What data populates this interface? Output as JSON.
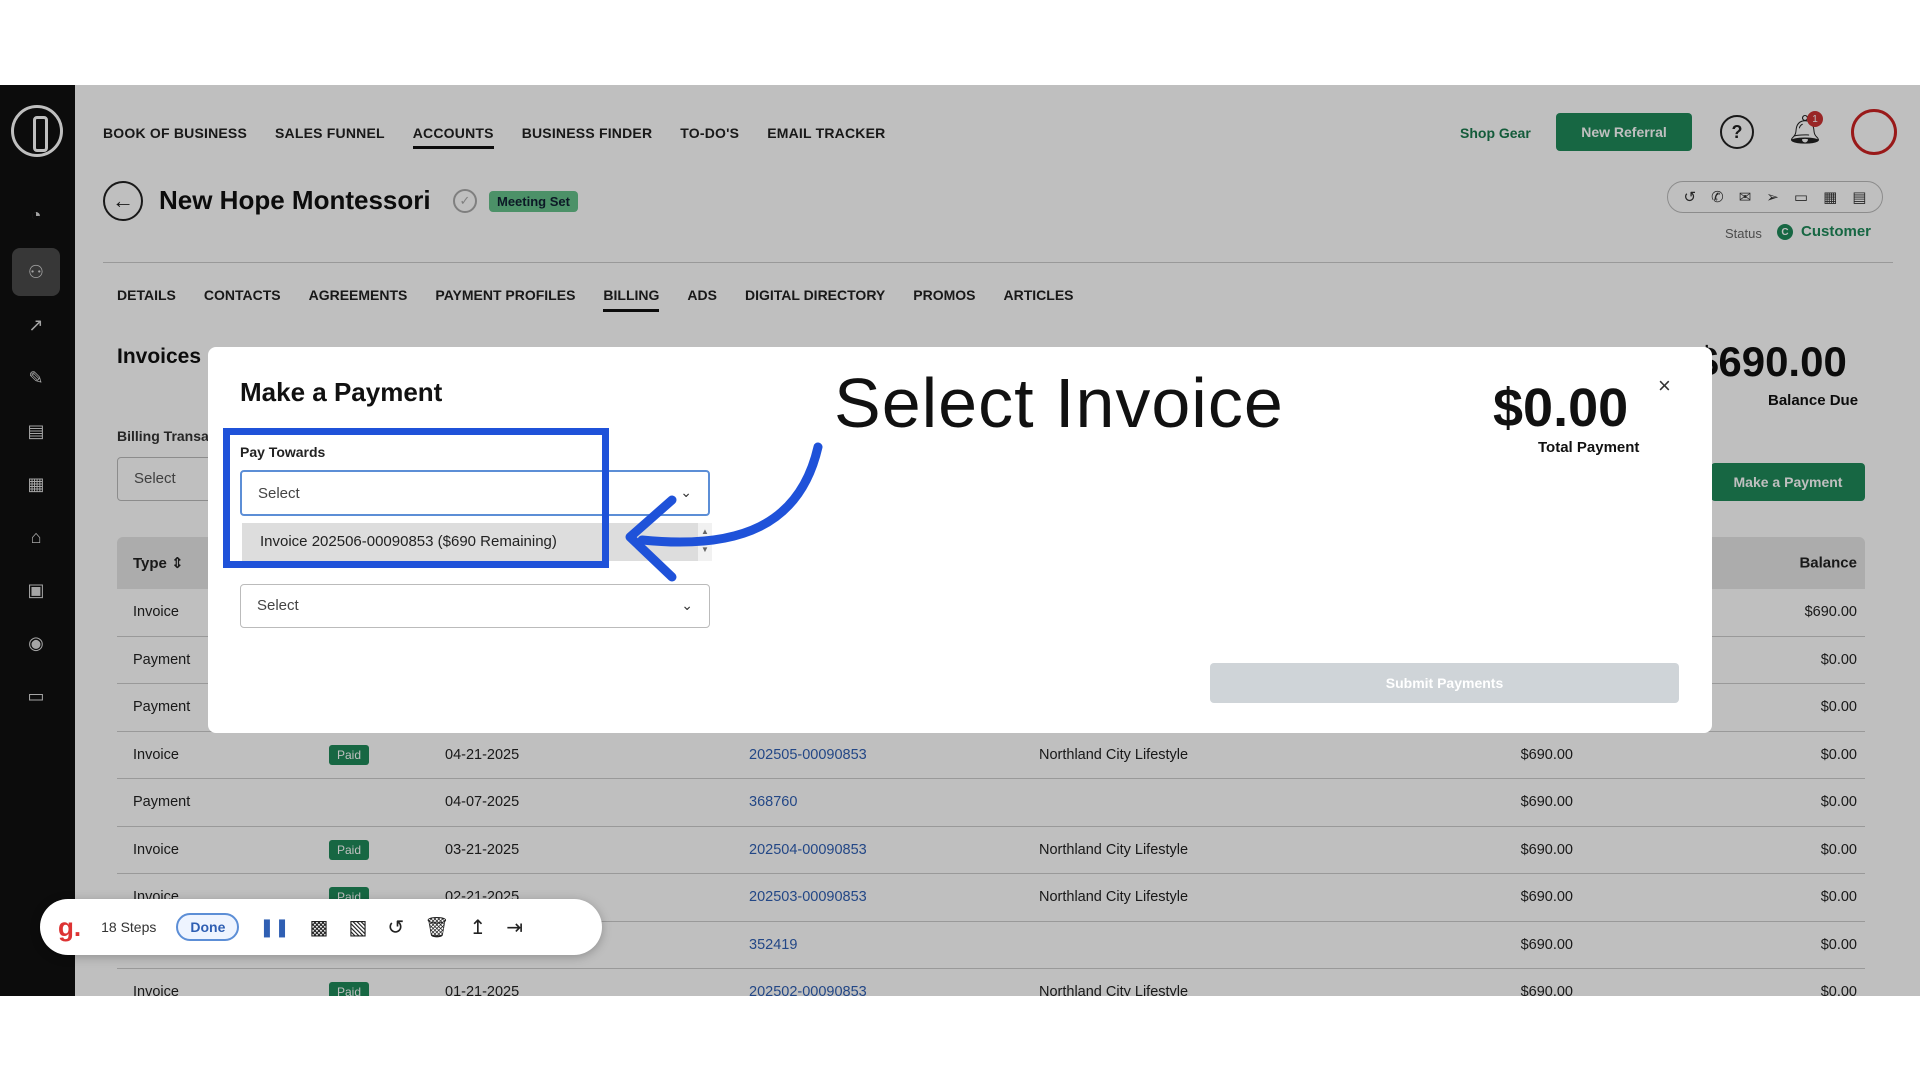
{
  "nav": {
    "items": [
      "BOOK OF BUSINESS",
      "SALES FUNNEL",
      "ACCOUNTS",
      "BUSINESS FINDER",
      "TO-DO'S",
      "EMAIL TRACKER"
    ],
    "shop_gear": "Shop Gear",
    "new_referral": "New Referral",
    "notification_count": "1"
  },
  "account": {
    "title": "New Hope Montessori",
    "badge": "Meeting Set",
    "status_label": "Status",
    "status_value": "Customer",
    "status_icon": "C"
  },
  "tabs": [
    "DETAILS",
    "CONTACTS",
    "AGREEMENTS",
    "PAYMENT PROFILES",
    "BILLING",
    "ADS",
    "DIGITAL DIRECTORY",
    "PROMOS",
    "ARTICLES"
  ],
  "billing": {
    "invoices_heading": "Invoices",
    "balance_amount": "$690.00",
    "balance_label": "Balance Due",
    "transactions_label": "Billing Transa",
    "transactions_select": "Select",
    "make_payment_button": "Make a Payment",
    "col_type": "Type",
    "col_balance": "Balance",
    "rows": [
      {
        "type": "Invoice",
        "badge": "",
        "date": "",
        "number": "",
        "publication": "",
        "amount": "",
        "balance": "$690.00"
      },
      {
        "type": "Payment",
        "badge": "",
        "date": "",
        "number": "",
        "publication": "",
        "amount": "",
        "balance": "$0.00"
      },
      {
        "type": "Payment",
        "badge": "",
        "date": "",
        "number": "",
        "publication": "",
        "amount": "",
        "balance": "$0.00"
      },
      {
        "type": "Invoice",
        "badge": "Paid",
        "date": "04-21-2025",
        "number": "202505-00090853",
        "publication": "Northland City Lifestyle",
        "amount": "$690.00",
        "balance": "$0.00"
      },
      {
        "type": "Payment",
        "badge": "",
        "date": "04-07-2025",
        "number": "368760",
        "publication": "",
        "amount": "$690.00",
        "balance": "$0.00"
      },
      {
        "type": "Invoice",
        "badge": "Paid",
        "date": "03-21-2025",
        "number": "202504-00090853",
        "publication": "Northland City Lifestyle",
        "amount": "$690.00",
        "balance": "$0.00"
      },
      {
        "type": "Invoice",
        "badge": "Paid",
        "date": "02-21-2025",
        "number": "202503-00090853",
        "publication": "Northland City Lifestyle",
        "amount": "$690.00",
        "balance": "$0.00"
      },
      {
        "type": "",
        "badge": "",
        "date": "",
        "number": "352419",
        "publication": "",
        "amount": "$690.00",
        "balance": "$0.00"
      },
      {
        "type": "Invoice",
        "badge": "Paid",
        "date": "01-21-2025",
        "number": "202502-00090853",
        "publication": "Northland City Lifestyle",
        "amount": "$690.00",
        "balance": "$0.00"
      }
    ]
  },
  "modal": {
    "title": "Make a Payment",
    "total_amount": "$0.00",
    "total_label": "Total Payment",
    "close": "×",
    "pay_towards_label": "Pay Towards",
    "pay_towards_value": "Select",
    "option_invoice": "Invoice 202506-00090853 ($690 Remaining)",
    "payment_method_value": "Select",
    "submit": "Submit Payments"
  },
  "annotation": {
    "text": "Select Invoice",
    "color": "#1f52d9"
  },
  "recorder": {
    "steps": "18 Steps",
    "done": "Done"
  }
}
